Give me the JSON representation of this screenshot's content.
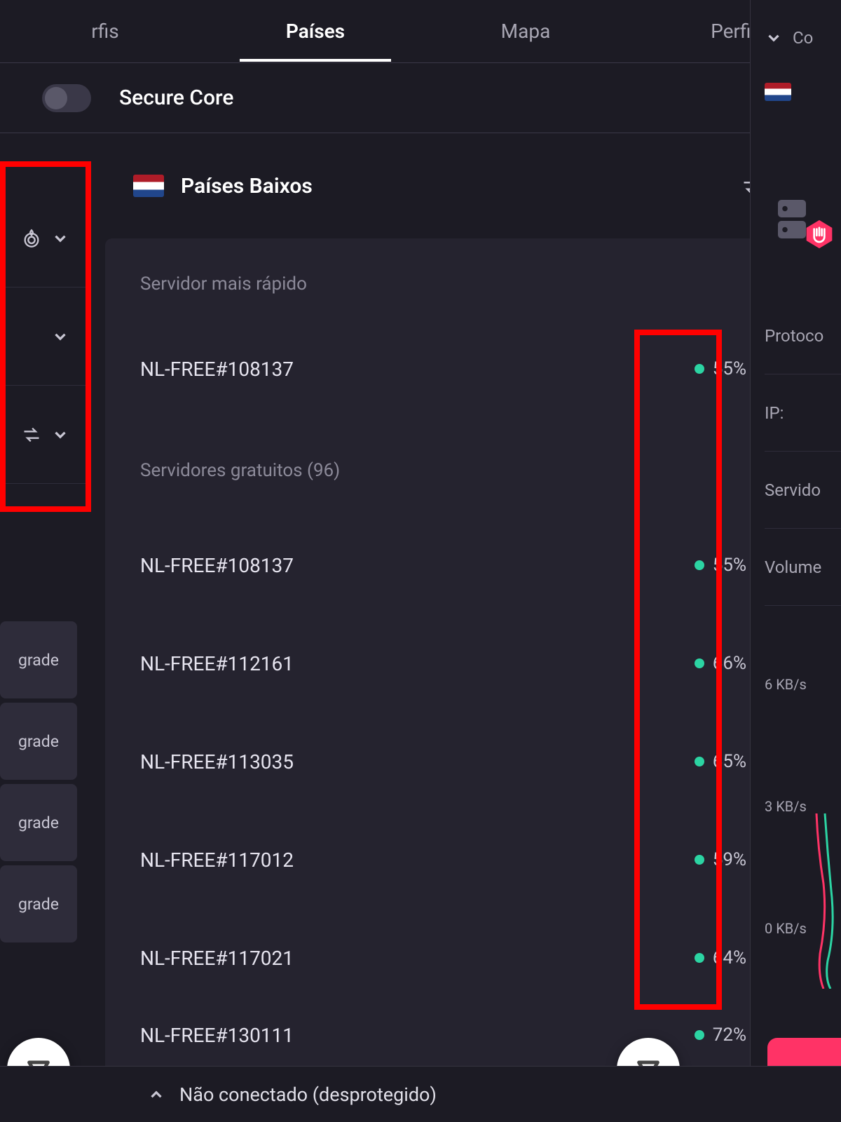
{
  "tabs": {
    "rfis": "rfis",
    "paises": "Países",
    "mapa": "Mapa",
    "perfis": "Perfis"
  },
  "secure_core": {
    "label": "Secure Core"
  },
  "country": {
    "name": "Países Baixos"
  },
  "hints": {
    "fastest": "Servidor mais rápido",
    "free_section": "Servidores gratuitos (96)"
  },
  "fastest_server": {
    "name": "NL-FREE#108137",
    "load": "55%"
  },
  "servers": [
    {
      "name": "NL-FREE#108137",
      "load": "55%"
    },
    {
      "name": "NL-FREE#112161",
      "load": "66%"
    },
    {
      "name": "NL-FREE#113035",
      "load": "65%"
    },
    {
      "name": "NL-FREE#117012",
      "load": "59%"
    },
    {
      "name": "NL-FREE#117021",
      "load": "64%"
    },
    {
      "name": "NL-FREE#130111",
      "load": "72%"
    }
  ],
  "upgrade_label": "grade",
  "status": "Não conectado (desprotegido)",
  "right": {
    "co": "Co",
    "protocol": "Protoco",
    "ip": "IP:",
    "server": "Servido",
    "volume": "Volume",
    "axis": {
      "top": "6 KB/s",
      "mid": "3 KB/s",
      "bot": "0 KB/s"
    }
  }
}
